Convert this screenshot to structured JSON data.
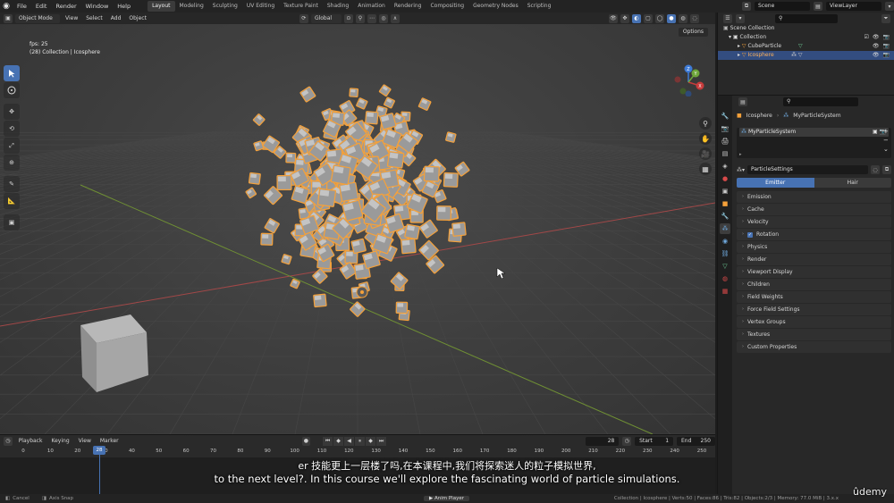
{
  "app": {
    "menus": [
      "File",
      "Edit",
      "Render",
      "Window",
      "Help"
    ],
    "workspaces": [
      "Layout",
      "Modeling",
      "Sculpting",
      "UV Editing",
      "Texture Paint",
      "Shading",
      "Animation",
      "Rendering",
      "Compositing",
      "Geometry Nodes",
      "Scripting"
    ],
    "active_workspace": "Layout",
    "scene": "Scene",
    "view_layer": "ViewLayer"
  },
  "viewport": {
    "mode": "Object Mode",
    "menus": [
      "View",
      "Select",
      "Add",
      "Object"
    ],
    "transform_orientation": "Global",
    "fps": "fps: 25",
    "collection_info": "(28) Collection | Icosphere",
    "options_label": "Options",
    "gizmo_labels": {
      "x": "X",
      "y": "Y",
      "z": "Z"
    }
  },
  "timeline": {
    "menus": [
      "Playback",
      "Keying",
      "View",
      "Marker"
    ],
    "current_frame": "28",
    "start_label": "Start",
    "start": "1",
    "end_label": "End",
    "end": "250",
    "ticks": [
      "0",
      "10",
      "20",
      "30",
      "40",
      "50",
      "60",
      "70",
      "80",
      "90",
      "100",
      "110",
      "120",
      "130",
      "140",
      "150",
      "160",
      "170",
      "180",
      "190",
      "200",
      "210",
      "220",
      "230",
      "240",
      "250"
    ],
    "playhead": "28"
  },
  "outliner": {
    "root": "Scene Collection",
    "items": [
      {
        "label": "Collection",
        "selected": false
      },
      {
        "label": "CubeParticle",
        "selected": false
      },
      {
        "label": "Icosphere",
        "selected": true
      }
    ]
  },
  "properties": {
    "breadcrumb_object": "Icosphere",
    "breadcrumb_system": "MyParticleSystem",
    "particle_system": "MyParticleSystem",
    "particle_settings": "ParticleSettings",
    "type_emitter": "Emitter",
    "type_hair": "Hair",
    "panels": [
      "Emission",
      "Cache",
      "Velocity",
      "Rotation",
      "Physics",
      "Render",
      "Viewport Display",
      "Children",
      "Field Weights",
      "Force Field Settings",
      "Vertex Groups",
      "Textures",
      "Custom Properties"
    ]
  },
  "statusbar": {
    "left1": "Cancel",
    "left2": "Axis Snap",
    "center": "Anim Player",
    "right": "Collection | Icosphere | Verts:50 | Faces:86 | Tris:82 | Objects:2/3 | Memory: 77.0 MiB | 3.x.x"
  },
  "subtitles": {
    "chinese": "er 技能更上一层楼了吗,在本课程中,我们将探索迷人的粒子模拟世界,",
    "english": "to the next level?. In this course we'll explore the fascinating world of particle simulations."
  },
  "watermark": "ûdemy",
  "colors": {
    "accent": "#4772b3",
    "selection_orange": "#f5a13a",
    "axis_x": "#c24545",
    "axis_y": "#7da33a"
  }
}
